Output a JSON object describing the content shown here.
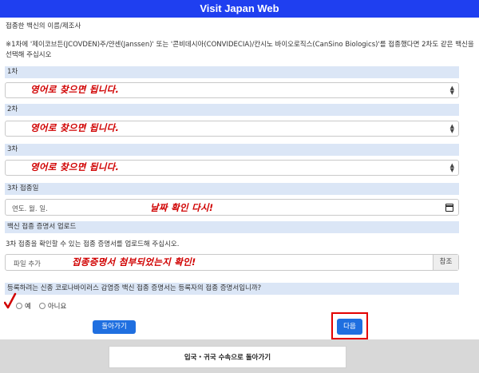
{
  "header": {
    "title": "Visit Japan Web"
  },
  "vaccine": {
    "section_title": "접종한 백신의 이름/제조사",
    "note_line1": "※1차에 '제이코브든(JCOVDEN)주/얀센(Janssen)' 또는 '콘비데시아(CONVIDECIA)/칸시노 바이오로직스(CanSino Biologics)'를 접종했다면 2차도 같은 백신을",
    "note_line2": "선택해 주십시오",
    "doses": [
      {
        "label": "1차",
        "annotation": "영어로 찾으면 됩니다."
      },
      {
        "label": "2차",
        "annotation": "영어로 찾으면 됩니다."
      },
      {
        "label": "3차",
        "annotation": "영어로 찾으면 됩니다."
      }
    ]
  },
  "date": {
    "label": "3차 접종일",
    "placeholder": "연도. 월. 일.",
    "annotation": "날짜 확인 다시!"
  },
  "upload": {
    "label": "백신 접종 증명서 업로드",
    "instruction": "3차 접종을 확인할 수 있는 접종 증명서를 업로드해 주십시오.",
    "placeholder": "파일 추가",
    "browse_label": "참조",
    "annotation": "접종증명서 첨부되었는지 확인!"
  },
  "question": {
    "text": "등록하려는 신종 코로나바이러스 감염증 백신 접종 증명서는 등록자의 접종 증명서입니까?",
    "options": [
      "예",
      "아니요"
    ]
  },
  "buttons": {
    "back": "돌아가기",
    "next": "다음"
  },
  "footer": {
    "label": "입국・귀국 수속으로 돌아가기"
  },
  "colors": {
    "header": "#1f3ff0",
    "section": "#dbe6f6",
    "button": "#1f6fe0",
    "annotation": "#d00000"
  }
}
